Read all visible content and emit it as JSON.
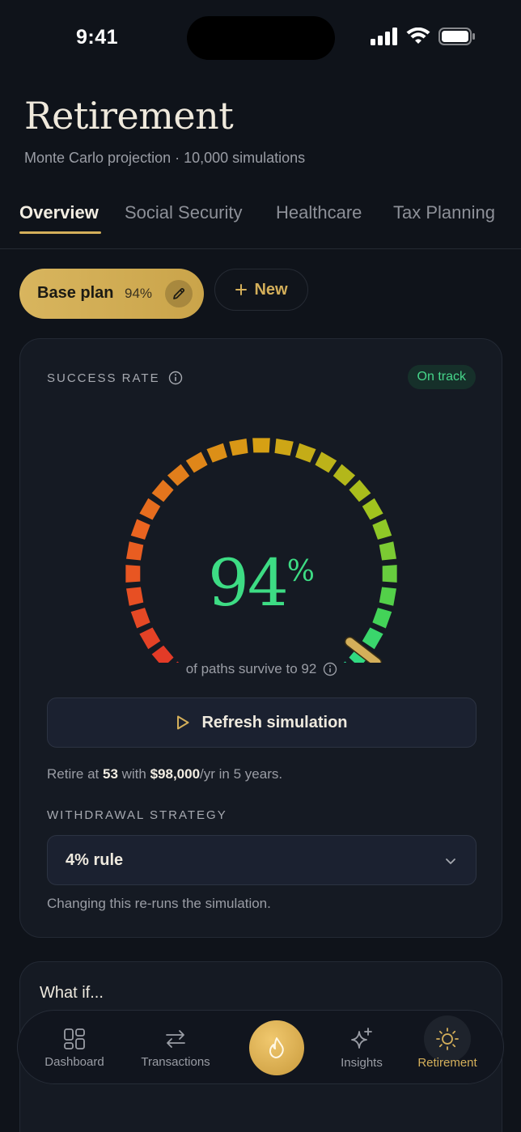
{
  "status": {
    "time": "9:41"
  },
  "header": {
    "title": "Retirement",
    "subtitle": "Monte Carlo projection · 10,000 simulations"
  },
  "tabs": [
    {
      "label": "Overview",
      "active": true
    },
    {
      "label": "Social Security",
      "active": false
    },
    {
      "label": "Healthcare",
      "active": false
    },
    {
      "label": "Tax Planning",
      "active": false
    }
  ],
  "plans": {
    "current": {
      "name": "Base plan",
      "pct": "94%"
    },
    "new_label": "New"
  },
  "success": {
    "label": "SUCCESS RATE",
    "badge": "On track",
    "value": "94",
    "value_unit": "%",
    "rate": 0.94,
    "caption": "of paths survive to 92",
    "refresh_label": "Refresh simulation",
    "retire_prefix": "Retire at ",
    "retire_age": "53",
    "retire_mid": " with ",
    "retire_amount": "$98,000",
    "retire_suffix": "/yr in 5 years."
  },
  "withdrawal": {
    "label": "WITHDRAWAL STRATEGY",
    "selected": "4% rule",
    "note": "Changing this re-runs the simulation."
  },
  "whatif": {
    "title": "What if..."
  },
  "nav": [
    {
      "label": "Dashboard",
      "icon": "dashboard-icon"
    },
    {
      "label": "Transactions",
      "icon": "transfer-arrows-icon"
    },
    {
      "label": "",
      "icon": "flame-icon"
    },
    {
      "label": "Insights",
      "icon": "sparkle-icon"
    },
    {
      "label": "Retirement",
      "icon": "sun-icon",
      "active": true
    }
  ],
  "colors": {
    "accent": "#d4af5a",
    "success": "#3ddc84",
    "background": "#0f131a",
    "card": "#151a23"
  }
}
